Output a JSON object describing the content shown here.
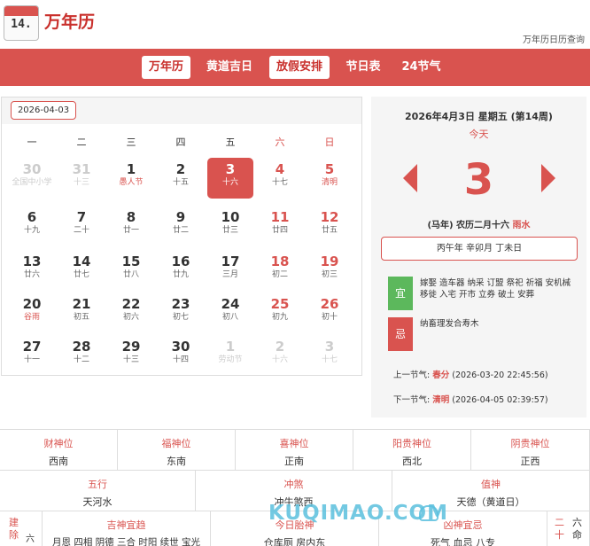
{
  "header": {
    "logo_number": "14.",
    "title": "万年历",
    "subtitle": "万年历日历查询"
  },
  "nav": {
    "items": [
      {
        "label": "万年历",
        "active": true
      },
      {
        "label": "黄道吉日",
        "active": false
      },
      {
        "label": "放假安排",
        "active": true
      },
      {
        "label": "节日表",
        "active": false
      },
      {
        "label": "24节气",
        "active": false
      }
    ]
  },
  "calendar": {
    "selected_date": "2026-04-03",
    "weekdays": [
      "一",
      "二",
      "三",
      "四",
      "五",
      "六",
      "日"
    ],
    "weeks": [
      [
        {
          "d": "30",
          "l": "全国中小学",
          "dim": true,
          "fest": true
        },
        {
          "d": "31",
          "l": "十三",
          "dim": true
        },
        {
          "d": "1",
          "l": "愚人节",
          "fest": true
        },
        {
          "d": "2",
          "l": "十五"
        },
        {
          "d": "3",
          "l": "十六",
          "today": true
        },
        {
          "d": "4",
          "l": "十七",
          "we": true
        },
        {
          "d": "5",
          "l": "清明",
          "we": true,
          "fest": true
        }
      ],
      [
        {
          "d": "6",
          "l": "十九"
        },
        {
          "d": "7",
          "l": "二十"
        },
        {
          "d": "8",
          "l": "廿一"
        },
        {
          "d": "9",
          "l": "廿二"
        },
        {
          "d": "10",
          "l": "廿三"
        },
        {
          "d": "11",
          "l": "廿四",
          "we": true
        },
        {
          "d": "12",
          "l": "廿五",
          "we": true
        }
      ],
      [
        {
          "d": "13",
          "l": "廿六"
        },
        {
          "d": "14",
          "l": "廿七"
        },
        {
          "d": "15",
          "l": "廿八"
        },
        {
          "d": "16",
          "l": "廿九"
        },
        {
          "d": "17",
          "l": "三月"
        },
        {
          "d": "18",
          "l": "初二",
          "we": true
        },
        {
          "d": "19",
          "l": "初三",
          "we": true
        }
      ],
      [
        {
          "d": "20",
          "l": "谷雨",
          "fest": true
        },
        {
          "d": "21",
          "l": "初五"
        },
        {
          "d": "22",
          "l": "初六"
        },
        {
          "d": "23",
          "l": "初七"
        },
        {
          "d": "24",
          "l": "初八"
        },
        {
          "d": "25",
          "l": "初九",
          "we": true
        },
        {
          "d": "26",
          "l": "初十",
          "we": true
        }
      ],
      [
        {
          "d": "27",
          "l": "十一"
        },
        {
          "d": "28",
          "l": "十二"
        },
        {
          "d": "29",
          "l": "十三"
        },
        {
          "d": "30",
          "l": "十四"
        },
        {
          "d": "1",
          "l": "劳动节",
          "dim": true,
          "fest": true
        },
        {
          "d": "2",
          "l": "十六",
          "dim": true,
          "we": true
        },
        {
          "d": "3",
          "l": "十七",
          "dim": true,
          "we": true
        }
      ]
    ]
  },
  "panel": {
    "full_date": "2026年4月3日 星期五 (第14周)",
    "today_label": "今天",
    "day": "3",
    "lunar": "(马年) 农历二月十六",
    "jieqi_now": "雨水",
    "ganzhi": "丙午年 辛卯月 丁未日",
    "yi_label": "宜",
    "yi_text": "嫁娶 造车器 纳采 订盟 祭祀 祈福 安机械 移徙 入宅 开市 立券 破土 安葬",
    "ji_label": "忌",
    "ji_text": "纳畜理发合寿木",
    "prev_label": "上一节气:",
    "prev_name": "春分",
    "prev_time": "(2026-03-20 22:45:56)",
    "next_label": "下一节气:",
    "next_name": "清明",
    "next_time": "(2026-04-05 02:39:57)"
  },
  "directions": [
    {
      "label": "财神位",
      "value": "西南"
    },
    {
      "label": "福神位",
      "value": "东南"
    },
    {
      "label": "喜神位",
      "value": "正南"
    },
    {
      "label": "阳贵神位",
      "value": "西北"
    },
    {
      "label": "阴贵神位",
      "value": "正西"
    }
  ],
  "row2": [
    {
      "label": "五行",
      "value": "天河水"
    },
    {
      "label": "冲煞",
      "value": "冲牛煞西"
    },
    {
      "label": "值神",
      "value": "天德（黄道日）"
    }
  ],
  "row3": {
    "left_col": [
      "建",
      "除"
    ],
    "left_small": "六",
    "ji_shen_label": "吉神宜趋",
    "ji_shen_value": "月恩 四相 阴德 三合 时阳 续世 宝光",
    "tai_shen_label": "今日胎神",
    "tai_shen_value": "仓库厕 房内东",
    "xiong_label": "凶神宜忌",
    "xiong_value": "死气 血忌 八专",
    "right_col": [
      "二",
      "十"
    ],
    "right_col2": [
      "六",
      "命"
    ]
  },
  "watermark": "KUQIMAO.COM"
}
